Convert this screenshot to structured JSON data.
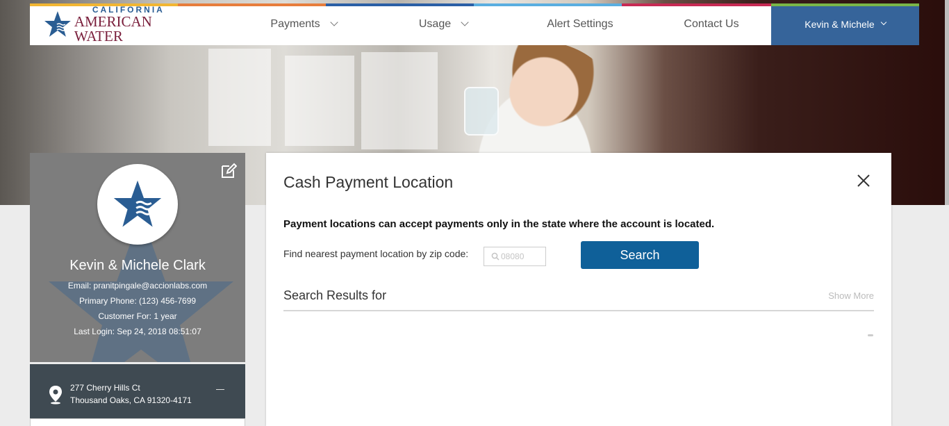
{
  "header": {
    "logo": {
      "line1": "CALIFORNIA",
      "line2": "AMERICAN WATER"
    },
    "nav": [
      {
        "label": "Payments",
        "dropdown": true
      },
      {
        "label": "Usage",
        "dropdown": true
      },
      {
        "label": "Alert Settings",
        "dropdown": false
      },
      {
        "label": "Contact Us",
        "dropdown": false
      }
    ],
    "user_menu": {
      "label": "Kevin & Michele"
    },
    "stripe_colors": [
      "#f2b632",
      "#e77d3c",
      "#2b5fa6",
      "#5aaee0",
      "#c72a54",
      "#7ab648"
    ]
  },
  "profile": {
    "name": "Kevin & Michele Clark",
    "email": "Email: pranitpingale@accionlabs.com",
    "phone": "Primary Phone: (123) 456-7699",
    "customer_for": "Customer For: 1 year",
    "last_login": "Last Login: Sep 24, 2018 08:51:07",
    "address_line1": "277 Cherry Hills Ct",
    "address_line2": "Thousand Oaks, CA 91320-4171"
  },
  "modal": {
    "title": "Cash Payment Location",
    "notice": "Payment locations can accept payments only in the state where the account is located.",
    "zip_label": "Find nearest payment location by zip code:",
    "zip_placeholder": "08080",
    "search_label": "Search",
    "results_label": "Search Results for",
    "show_more_label": "Show More"
  },
  "colors": {
    "brand_blue": "#2a5d93",
    "brand_maroon": "#7a1f3c",
    "user_menu_bg": "#36649a",
    "button_bg": "#0f6099"
  }
}
